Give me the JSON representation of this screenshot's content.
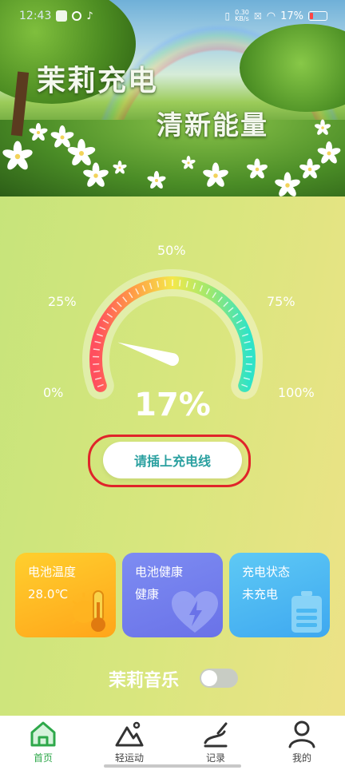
{
  "status_bar": {
    "time": "12:43",
    "net_speed_value": "0.30",
    "net_speed_unit": "KB/s",
    "battery_text": "17%",
    "icons": [
      "notification-icon",
      "signal-icon",
      "tiktok-icon",
      "vibrate-icon",
      "sim-icon",
      "wifi-icon",
      "battery-icon"
    ]
  },
  "banner": {
    "title": "茉莉充电",
    "subtitle": "清新能量"
  },
  "gauge": {
    "tick_labels": [
      "0%",
      "25%",
      "50%",
      "75%",
      "100%"
    ],
    "level_percent": 17,
    "value_text": "17%"
  },
  "actions": {
    "plug_hint": "请插上充电线",
    "highlight_color": "#e0242a"
  },
  "cards": [
    {
      "title": "电池温度",
      "value": "28.0℃",
      "icon": "thermometer-sun-icon",
      "color": "#ffb81f"
    },
    {
      "title": "电池健康",
      "value": "健康",
      "icon": "heart-bolt-icon",
      "color": "#7280ee"
    },
    {
      "title": "充电状态",
      "value": "未充电",
      "icon": "battery-icon",
      "color": "#4bb8f2"
    }
  ],
  "music": {
    "label": "茉莉音乐",
    "enabled": false
  },
  "nav": {
    "items": [
      {
        "label": "首页",
        "icon": "home-icon",
        "active": true
      },
      {
        "label": "轻运动",
        "icon": "mountain-icon",
        "active": false
      },
      {
        "label": "记录",
        "icon": "pen-record-icon",
        "active": false
      },
      {
        "label": "我的",
        "icon": "user-icon",
        "active": false
      }
    ],
    "active_color": "#2ea84a"
  }
}
